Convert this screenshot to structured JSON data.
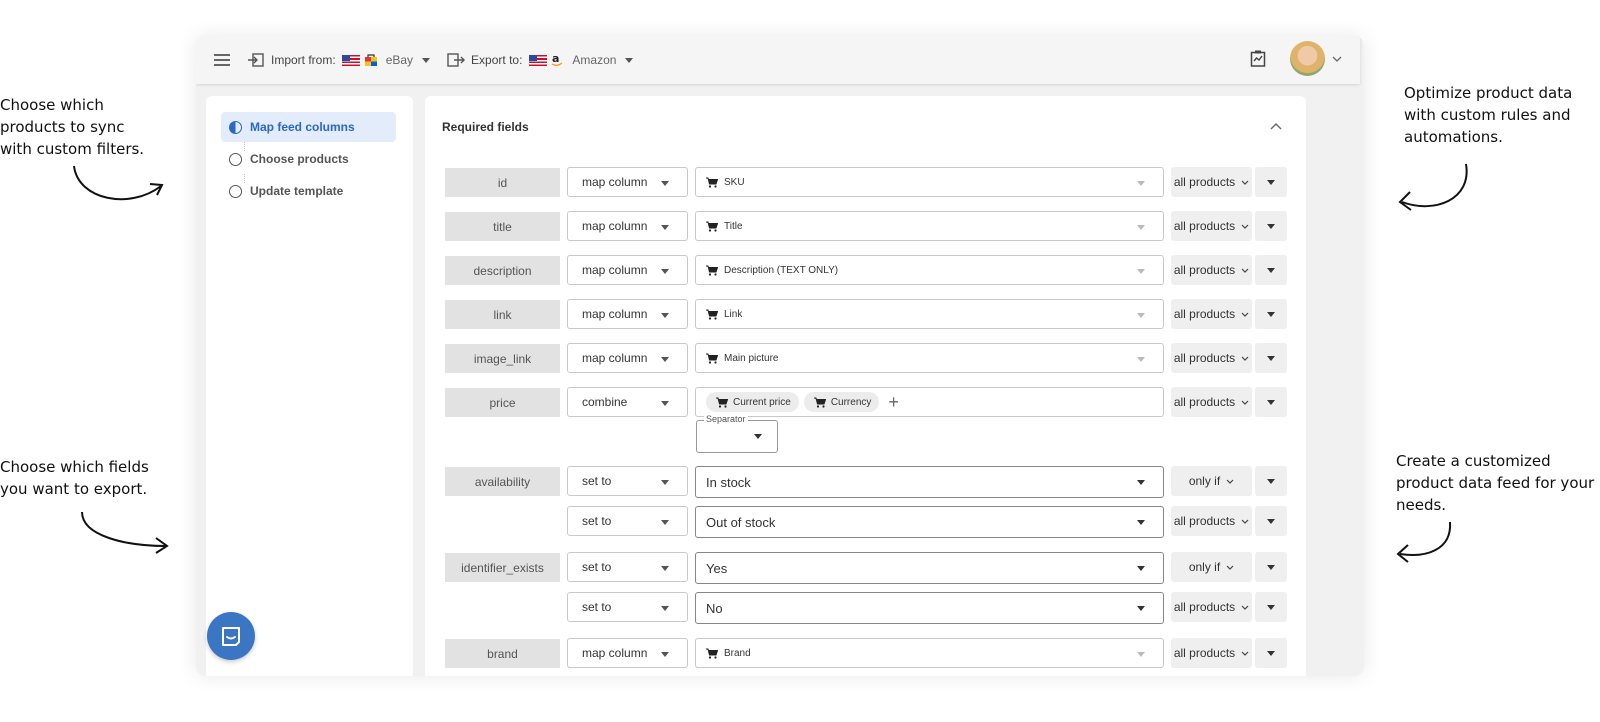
{
  "annotations": [
    {
      "text": "Choose which products to sync with custom filters."
    },
    {
      "text": "Choose which fields you want to export."
    },
    {
      "text": "Optimize product data with custom rules and automations."
    },
    {
      "text": "Create a customized product data feed for your needs."
    }
  ],
  "topbar": {
    "import_label": "Import from:",
    "import_source": "eBay",
    "export_label": "Export to:",
    "export_target": "Amazon"
  },
  "sidebar": {
    "steps": [
      {
        "label": "Map feed columns",
        "active": true
      },
      {
        "label": "Choose products",
        "active": false
      },
      {
        "label": "Update template",
        "active": false
      }
    ]
  },
  "main": {
    "section_title": "Required fields",
    "rows": [
      {
        "field": "id",
        "mode": "map column",
        "value": "SKU",
        "scope": "all products"
      },
      {
        "field": "title",
        "mode": "map column",
        "value": "Title",
        "scope": "all products"
      },
      {
        "field": "description",
        "mode": "map column",
        "value": "Description (TEXT ONLY)",
        "scope": "all products"
      },
      {
        "field": "link",
        "mode": "map column",
        "value": "Link",
        "scope": "all products"
      },
      {
        "field": "image_link",
        "mode": "map column",
        "value": "Main picture",
        "scope": "all products"
      },
      {
        "field": "price",
        "mode": "combine",
        "chips": [
          "Current price",
          "Currency"
        ],
        "separator_label": "Separator",
        "scope": "all products"
      },
      {
        "field": "availability",
        "mode": "set to",
        "value": "In stock",
        "scope": "only if"
      },
      {
        "field": "",
        "mode": "set to",
        "value": "Out of stock",
        "scope": "all products"
      },
      {
        "field": "identifier_exists",
        "mode": "set to",
        "value": "Yes",
        "scope": "only if"
      },
      {
        "field": "",
        "mode": "set to",
        "value": "No",
        "scope": "all products"
      },
      {
        "field": "brand",
        "mode": "map column",
        "value": "Brand",
        "scope": "all products"
      }
    ]
  },
  "colors": {
    "accent": "#2a67c6",
    "active_bg": "#e3ecfb",
    "chat": "#3a76c4"
  },
  "icons": [
    "menu-icon",
    "import-icon",
    "us-flag-icon",
    "ebay-icon",
    "export-icon",
    "amazon-icon",
    "report-icon",
    "avatar",
    "chevron-up-icon",
    "cart-icon",
    "plus-icon",
    "chat-icon"
  ]
}
